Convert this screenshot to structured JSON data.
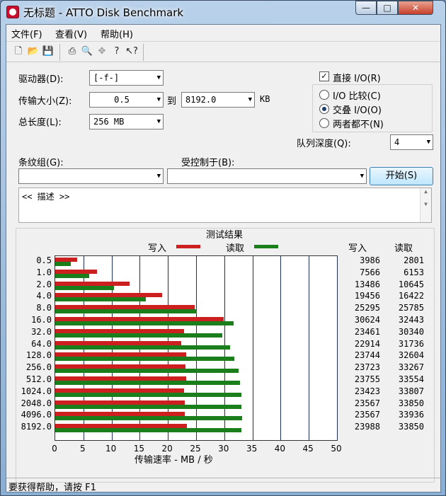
{
  "window": {
    "title": "无标题 - ATTO Disk Benchmark",
    "minimize": "—",
    "maximize": "□",
    "close": "✕"
  },
  "menu": [
    "文件(F)",
    "查看(V)",
    "帮助(H)"
  ],
  "toolbar": [
    "new-icon",
    "open-icon",
    "save-icon",
    "print-icon",
    "print-preview-icon",
    "move-icon",
    "help-icon",
    "context-help-icon"
  ],
  "form": {
    "drive_label": "驱动器(D):",
    "drive_value": "[-f-]",
    "transfer_label": "传输大小(Z):",
    "transfer_from": "0.5",
    "to_label": "到",
    "transfer_to": "8192.0",
    "kb": "KB",
    "length_label": "总长度(L):",
    "length_value": "256 MB",
    "direct_io": "直接 I/O(R)",
    "direct_io_checked": true,
    "radio_compare": "I/O 比较(C)",
    "radio_overlap": "交叠 I/O(O)",
    "radio_neither": "两者都不(N)",
    "queue_label": "队列深度(Q):",
    "queue_value": "4",
    "stripe_label": "条纹组(G):",
    "controlled_label": "受控制于(B):",
    "start_button": "开始(S)",
    "description": "<< 描述 >>"
  },
  "results": {
    "title": "测试结果",
    "legend_write": "写入",
    "legend_read": "读取",
    "col_write": "写入",
    "col_read": "读取",
    "xlabel": "传输速率 - MB / 秒"
  },
  "colors": {
    "write": "#cc1f1f",
    "read": "#1a7f1a"
  },
  "chart_data": {
    "type": "bar",
    "title": "测试结果",
    "xlabel": "传输速率 - MB / 秒",
    "xlim": [
      0,
      50
    ],
    "xticks": [
      "0",
      "5",
      "10",
      "15",
      "20",
      "25",
      "30",
      "35",
      "40",
      "45",
      "50"
    ],
    "categories": [
      "0.5",
      "1.0",
      "2.0",
      "4.0",
      "8.0",
      "16.0",
      "32.0",
      "64.0",
      "128.0",
      "256.0",
      "512.0",
      "1024.0",
      "2048.0",
      "4096.0",
      "8192.0"
    ],
    "series": [
      {
        "name": "写入",
        "values": [
          3986,
          7566,
          13486,
          19456,
          25295,
          30624,
          23461,
          22914,
          23744,
          23723,
          23755,
          23423,
          23567,
          23567,
          23988
        ]
      },
      {
        "name": "读取",
        "values": [
          2801,
          6153,
          10645,
          16422,
          25785,
          32443,
          30340,
          31736,
          32604,
          33267,
          33554,
          33807,
          33850,
          33936,
          33850
        ]
      }
    ]
  },
  "status": "要获得帮助，请按 F1"
}
